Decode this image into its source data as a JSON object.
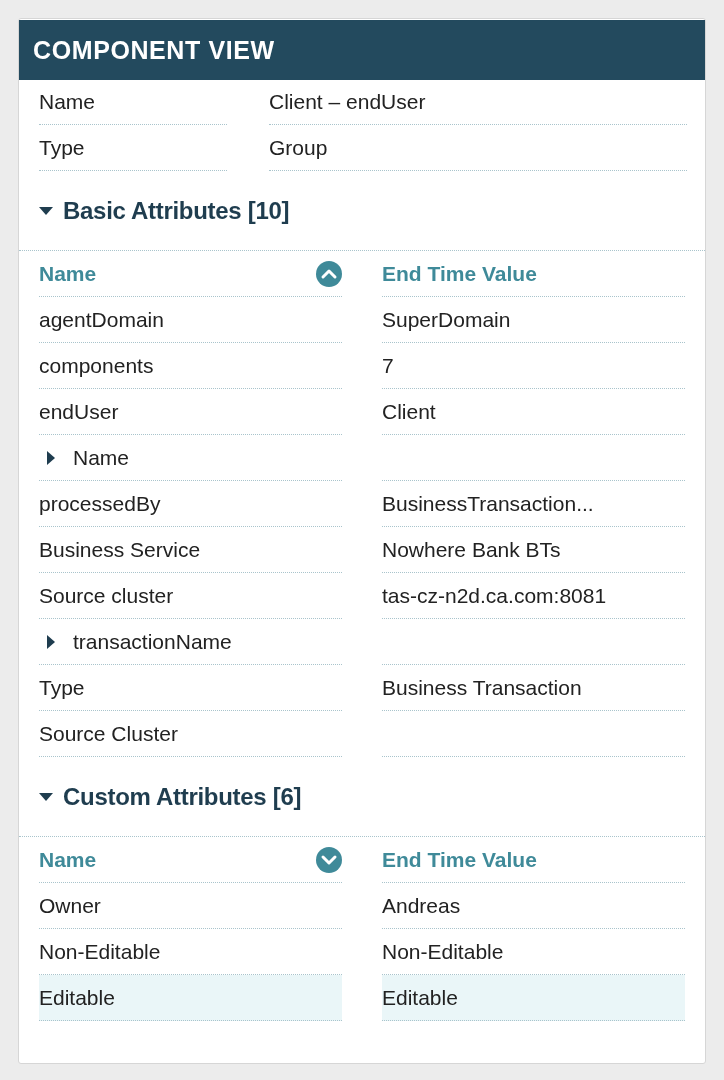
{
  "panel": {
    "title": "COMPONENT VIEW",
    "properties": [
      {
        "label": "Name",
        "value": "Client – endUser"
      },
      {
        "label": "Type",
        "value": "Group"
      }
    ],
    "sections": [
      {
        "title": "Basic Attributes [10]",
        "expanded": true,
        "columns": [
          {
            "label": "Name",
            "descending": false
          },
          {
            "label": "End Time Value"
          }
        ],
        "rows": [
          {
            "kind": "item",
            "name": "agentDomain",
            "value": "SuperDomain",
            "selected": false
          },
          {
            "kind": "item",
            "name": "components",
            "value": "7",
            "selected": false
          },
          {
            "kind": "item",
            "name": "endUser",
            "value": "Client",
            "selected": false
          },
          {
            "kind": "group",
            "name": "Name",
            "expanded": false,
            "selected": false
          },
          {
            "kind": "item",
            "name": "processedBy",
            "value": "BusinessTransaction...",
            "selected": false
          },
          {
            "kind": "item",
            "name": "Business Service",
            "value": "Nowhere Bank BTs",
            "selected": false
          },
          {
            "kind": "item",
            "name": "Source cluster",
            "value": "tas-cz-n2d.ca.com:8081",
            "selected": false
          },
          {
            "kind": "group",
            "name": "transactionName",
            "expanded": false,
            "selected": false
          },
          {
            "kind": "item",
            "name": "Type",
            "value": "Business Transaction",
            "selected": false
          },
          {
            "kind": "item",
            "name": "Source Cluster",
            "selected": false
          }
        ]
      },
      {
        "title": "Custom Attributes [6]",
        "expanded": true,
        "columns": [
          {
            "label": "Name",
            "descending": true
          },
          {
            "label": "End Time Value"
          }
        ],
        "rows": [
          {
            "kind": "item",
            "name": "Owner",
            "value": "Andreas",
            "selected": false
          },
          {
            "kind": "item",
            "name": "Non-Editable",
            "value": "Non-Editable",
            "selected": false
          },
          {
            "kind": "item",
            "name": "Editable",
            "value": "Editable",
            "selected": true
          }
        ]
      }
    ]
  }
}
